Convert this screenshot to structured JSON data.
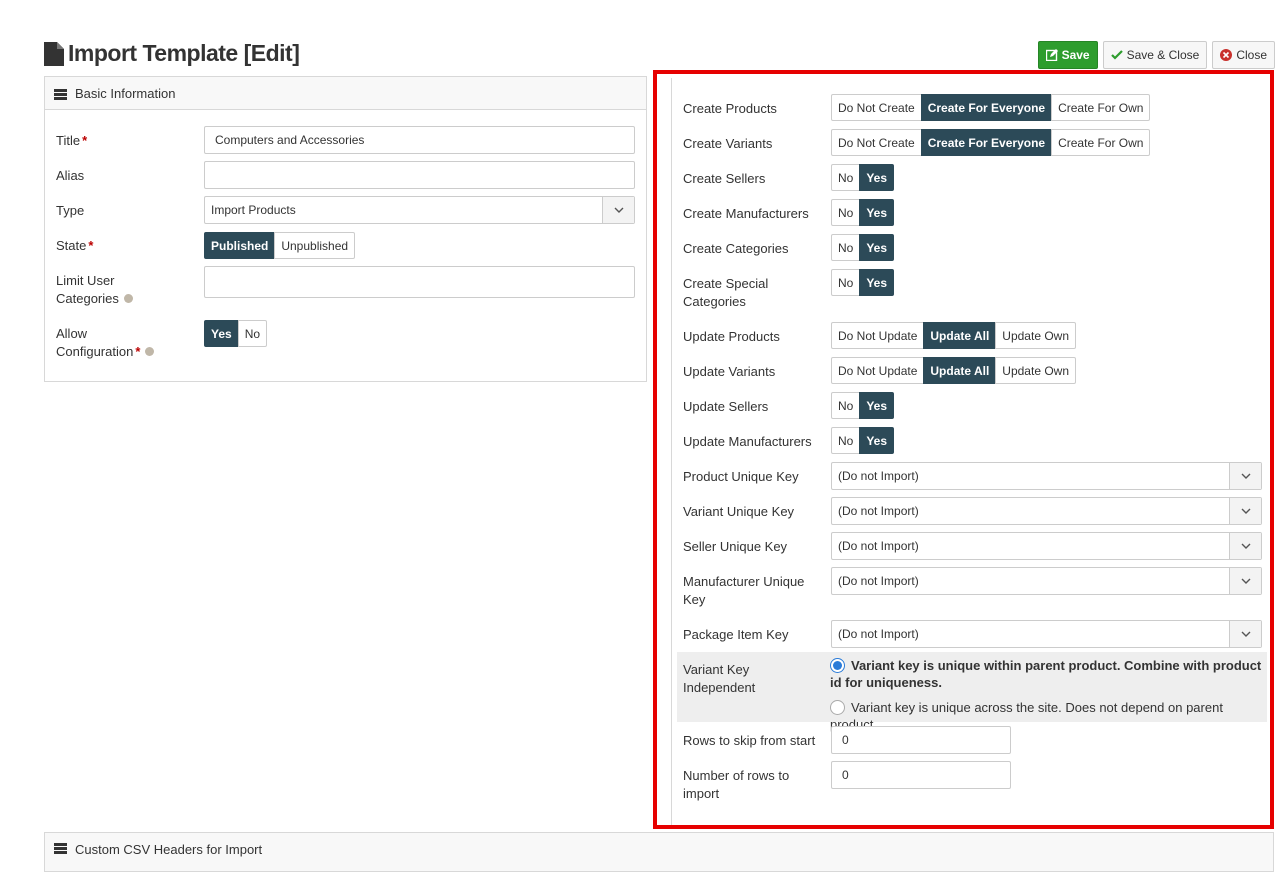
{
  "page": {
    "title": "Import Template [Edit]"
  },
  "toolbar": {
    "save": "Save",
    "save_close": "Save & Close",
    "close": "Close"
  },
  "colors": {
    "active": "#2c4a58",
    "save": "#2e9d2e",
    "highlight": "#e60000"
  },
  "basic": {
    "heading": "Basic Information",
    "title_label": "Title",
    "title_value": "Computers and Accessories",
    "alias_label": "Alias",
    "alias_value": "",
    "type_label": "Type",
    "type_value": "Import Products",
    "state_label": "State",
    "state_options": [
      "Published",
      "Unpublished"
    ],
    "limit_label_1": "Limit User",
    "limit_label_2": "Categories",
    "limit_value": "",
    "allow_label_1": "Allow",
    "allow_label_2": "Configuration",
    "allow_options": [
      "Yes",
      "No"
    ]
  },
  "options": {
    "create_products": {
      "label": "Create Products",
      "options": [
        "Do Not Create",
        "Create For Everyone",
        "Create For Own"
      ],
      "selected": "Create For Everyone"
    },
    "create_variants": {
      "label": "Create Variants",
      "options": [
        "Do Not Create",
        "Create For Everyone",
        "Create For Own"
      ],
      "selected": "Create For Everyone"
    },
    "create_sellers": {
      "label": "Create Sellers",
      "options": [
        "No",
        "Yes"
      ],
      "selected": "Yes"
    },
    "create_manufacturers": {
      "label": "Create Manufacturers",
      "options": [
        "No",
        "Yes"
      ],
      "selected": "Yes"
    },
    "create_categories": {
      "label": "Create Categories",
      "options": [
        "No",
        "Yes"
      ],
      "selected": "Yes"
    },
    "create_special": {
      "label_1": "Create Special",
      "label_2": "Categories",
      "options": [
        "No",
        "Yes"
      ],
      "selected": "Yes"
    },
    "update_products": {
      "label": "Update Products",
      "options": [
        "Do Not Update",
        "Update All",
        "Update Own"
      ],
      "selected": "Update All"
    },
    "update_variants": {
      "label": "Update Variants",
      "options": [
        "Do Not Update",
        "Update All",
        "Update Own"
      ],
      "selected": "Update All"
    },
    "update_sellers": {
      "label": "Update Sellers",
      "options": [
        "No",
        "Yes"
      ],
      "selected": "Yes"
    },
    "update_manufacturers": {
      "label": "Update Manufacturers",
      "options": [
        "No",
        "Yes"
      ],
      "selected": "Yes"
    },
    "product_key": {
      "label": "Product Unique Key",
      "value": "(Do not Import)"
    },
    "variant_key": {
      "label": "Variant Unique Key",
      "value": "(Do not Import)"
    },
    "seller_key": {
      "label": "Seller Unique Key",
      "value": "(Do not Import)"
    },
    "manufacturer_key": {
      "label_1": "Manufacturer Unique",
      "label_2": "Key",
      "value": "(Do not Import)"
    },
    "package_key": {
      "label": "Package Item Key",
      "value": "(Do not Import)"
    },
    "variant_independent": {
      "label_1": "Variant Key",
      "label_2": "Independent",
      "option_1": "Variant key is unique within parent product. Combine with product id for uniqueness.",
      "option_2": "Variant key is unique across the site. Does not depend on parent product."
    },
    "rows_skip": {
      "label": "Rows to skip from start",
      "value": "0"
    },
    "rows_import": {
      "label_1": "Number of rows to",
      "label_2": "import",
      "value": "0"
    }
  },
  "custom_headers": {
    "heading": "Custom CSV Headers for Import"
  }
}
